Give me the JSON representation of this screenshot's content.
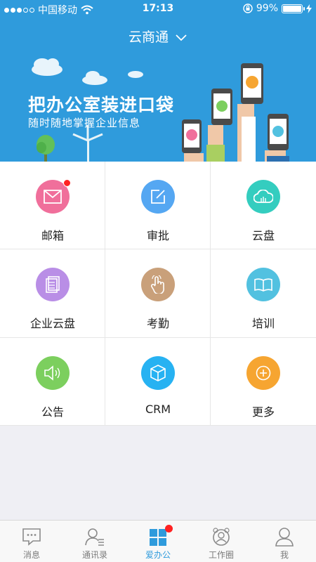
{
  "status_bar": {
    "carrier": "中国移动",
    "time": "17:13",
    "battery": "99%",
    "battery_level": 0.99
  },
  "header": {
    "title": "云商通"
  },
  "banner": {
    "headline": "把办公室装进口袋",
    "subtitle": "随时随地掌握企业信息"
  },
  "apps": [
    {
      "label": "邮箱",
      "icon": "mail-icon",
      "color": "#f06f9b",
      "badge": true
    },
    {
      "label": "审批",
      "icon": "edit-icon",
      "color": "#55a7f2",
      "badge": false
    },
    {
      "label": "云盘",
      "icon": "cloud-icon",
      "color": "#34cdbf",
      "badge": false
    },
    {
      "label": "企业云盘",
      "icon": "document-icon",
      "color": "#b98ee6",
      "badge": false
    },
    {
      "label": "考勤",
      "icon": "hand-touch-icon",
      "color": "#c9a07a",
      "badge": false
    },
    {
      "label": "培训",
      "icon": "book-icon",
      "color": "#52c1e0",
      "badge": false
    },
    {
      "label": "公告",
      "icon": "speaker-icon",
      "color": "#7ccf5e",
      "badge": false
    },
    {
      "label": "CRM",
      "icon": "cube-icon",
      "color": "#27b2f2",
      "badge": false
    },
    {
      "label": "更多",
      "icon": "plus-icon",
      "color": "#f6a531",
      "badge": false
    }
  ],
  "tabs": [
    {
      "label": "消息",
      "icon": "message-icon",
      "active": false
    },
    {
      "label": "通讯录",
      "icon": "contacts-icon",
      "active": false
    },
    {
      "label": "爱办公",
      "icon": "apps-grid-icon",
      "active": true,
      "badge": true
    },
    {
      "label": "工作圈",
      "icon": "circle-icon",
      "active": false
    },
    {
      "label": "我",
      "icon": "person-icon",
      "active": false
    }
  ],
  "colors": {
    "primary": "#2f9bdc",
    "badge": "#ff2222"
  }
}
